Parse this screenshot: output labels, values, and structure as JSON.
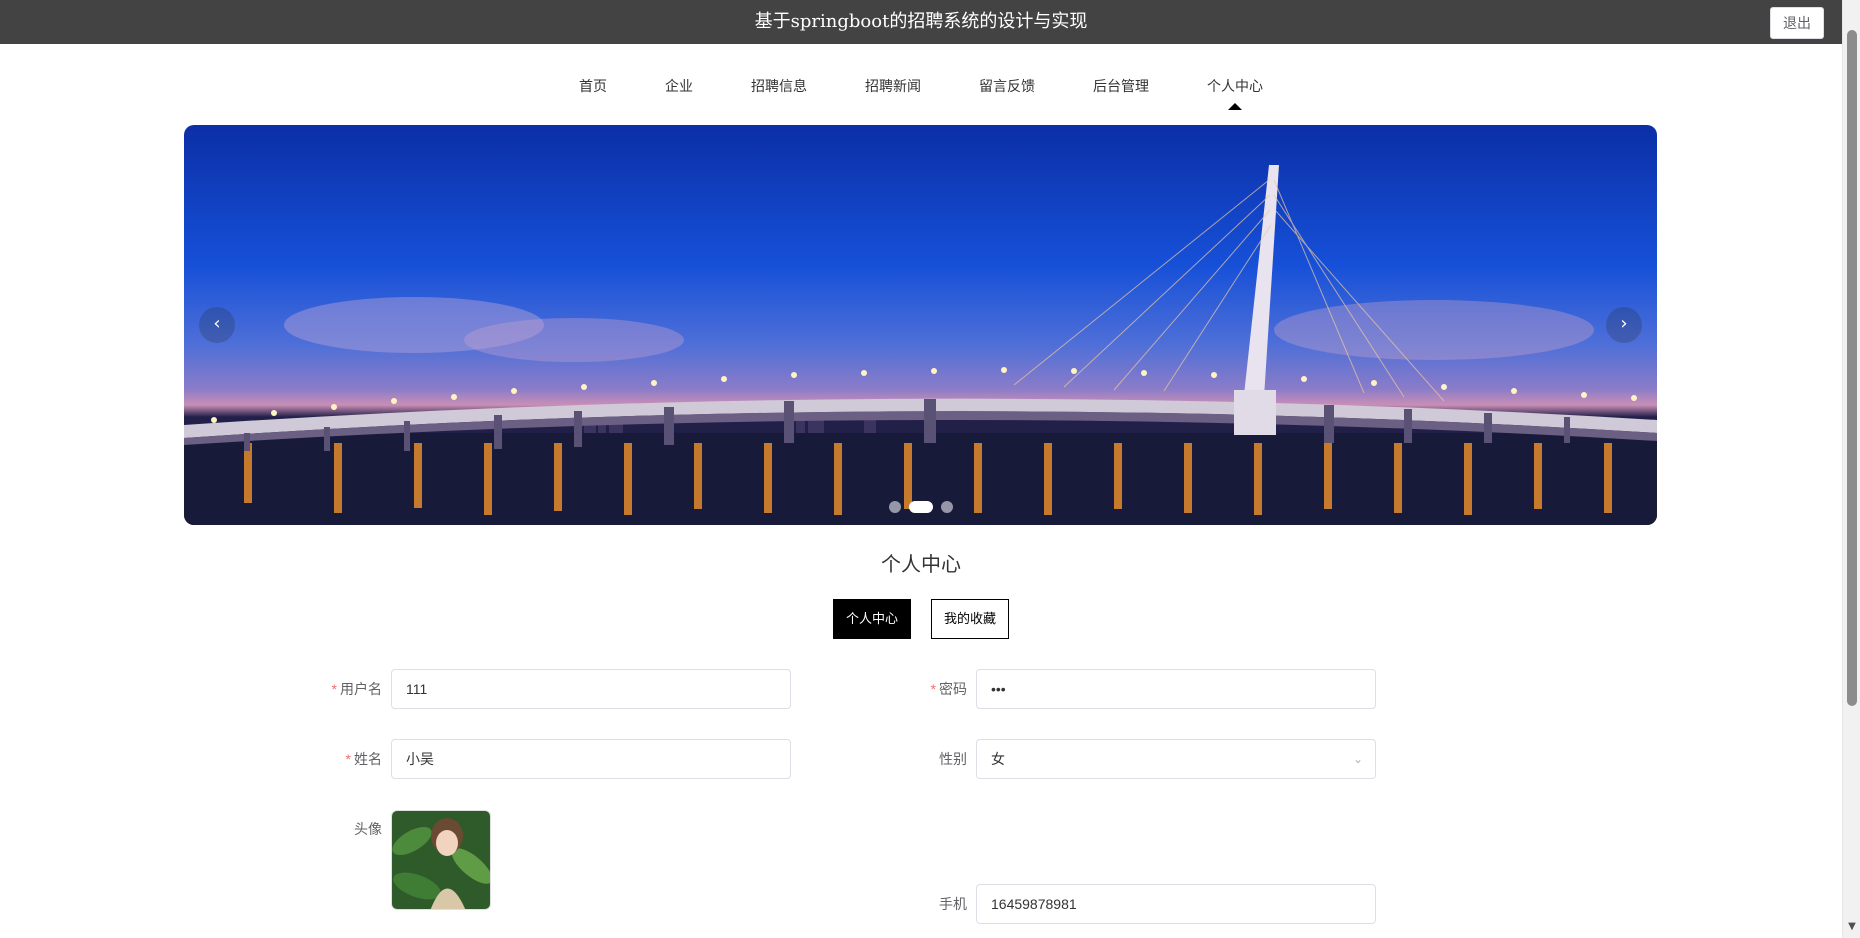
{
  "header": {
    "title": "基于springboot的招聘系统的设计与实现",
    "logout_label": "退出"
  },
  "nav": {
    "items": [
      {
        "label": "首页"
      },
      {
        "label": "企业"
      },
      {
        "label": "招聘信息"
      },
      {
        "label": "招聘新闻"
      },
      {
        "label": "留言反馈"
      },
      {
        "label": "后台管理"
      },
      {
        "label": "个人中心"
      }
    ],
    "active_index": 6
  },
  "banner": {
    "prev_label": "‹",
    "next_label": "›",
    "slide_count": 3,
    "active_slide": 2
  },
  "section": {
    "title": "个人中心"
  },
  "tabs": [
    {
      "label": "个人中心"
    },
    {
      "label": "我的收藏"
    }
  ],
  "form": {
    "username": {
      "label": "用户名",
      "value": "111",
      "required": true
    },
    "password": {
      "label": "密码",
      "value": "•••",
      "required": true
    },
    "name": {
      "label": "姓名",
      "value": "小吴",
      "required": true
    },
    "gender": {
      "label": "性别",
      "value": "女"
    },
    "avatar": {
      "label": "头像"
    },
    "phone": {
      "label": "手机",
      "value": "16459878981"
    }
  },
  "colors": {
    "topbar": "#434343",
    "required": "#f56c6c",
    "active_tab": "#000000"
  }
}
